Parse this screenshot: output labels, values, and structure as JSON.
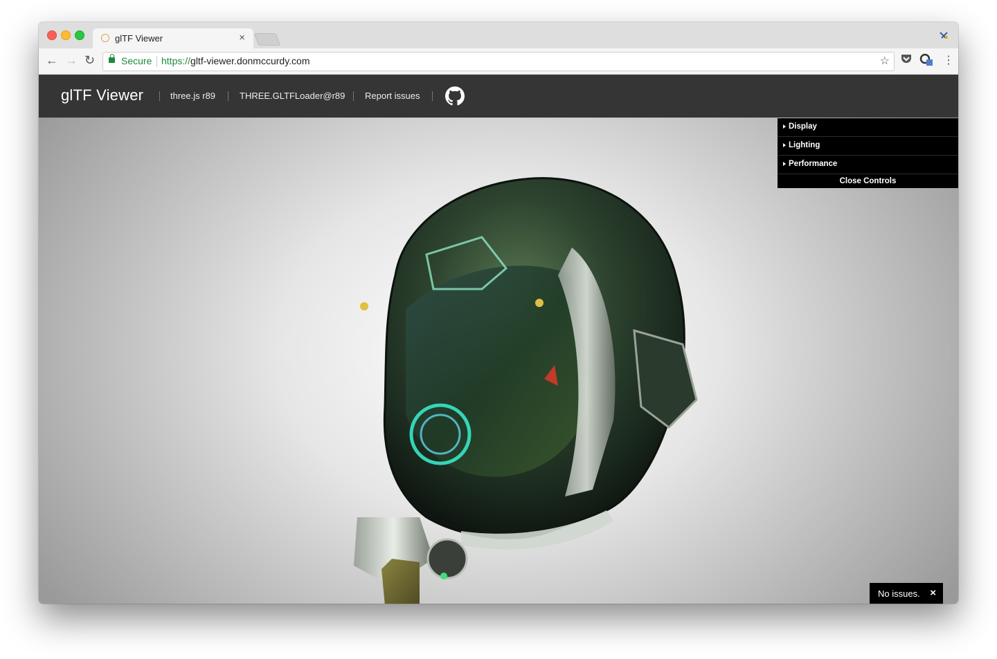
{
  "browser": {
    "tab_title": "glTF Viewer",
    "tab_close": "×",
    "secure_label": "Secure",
    "url_scheme": "https://",
    "url_host": "gltf-viewer.donmccurdy.com",
    "back_icon": "←",
    "forward_icon": "→",
    "reload_icon": "↻",
    "bookmark_icon": "☆",
    "menu_icon": "⋮"
  },
  "header": {
    "brand": "glTF Viewer",
    "links": [
      "three.js r89",
      "THREE.GLTFLoader@r89",
      "Report issues"
    ]
  },
  "controls": {
    "folders": [
      "Display",
      "Lighting",
      "Performance"
    ],
    "close_label": "Close Controls"
  },
  "status": {
    "message": "No issues.",
    "close": "×"
  },
  "colors": {
    "header_bg": "#353535",
    "controls_bg": "#000000",
    "secure_green": "#1e8a3a"
  }
}
